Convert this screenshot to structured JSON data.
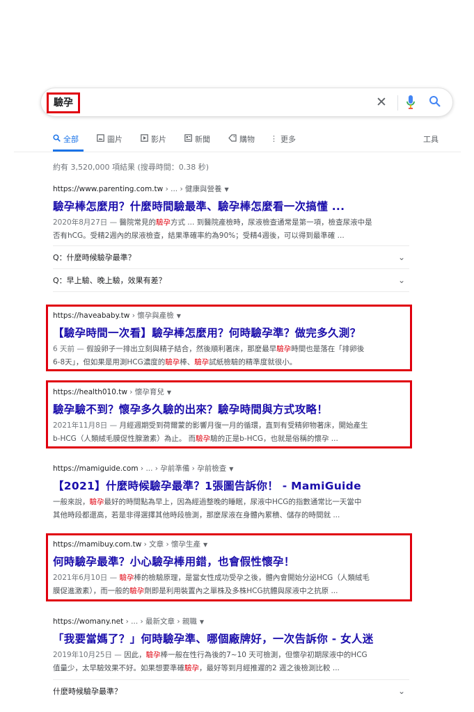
{
  "search": {
    "query": "驗孕",
    "clear_icon": "close-icon",
    "mic_icon": "microphone-icon",
    "search_icon": "search-icon"
  },
  "tabs": [
    {
      "label": "全部",
      "icon": "search-icon"
    },
    {
      "label": "圖片",
      "icon": "image-icon"
    },
    {
      "label": "影片",
      "icon": "video-icon"
    },
    {
      "label": "新聞",
      "icon": "news-icon"
    },
    {
      "label": "購物",
      "icon": "tag-icon"
    },
    {
      "label": "更多",
      "icon": "more-icon"
    },
    {
      "label": "工具",
      "icon": ""
    }
  ],
  "stats": "約有 3,520,000 項結果 (搜尋時間：0.38 秒)",
  "results": [
    {
      "site": "https://www.parenting.com.tw",
      "crumbs": " › ... › 健康與營養",
      "title": "驗孕棒怎麼用？什麼時間驗最準、驗孕棒怎麼看一次搞懂 ...",
      "date": "2020年8月27日 —",
      "line1a": " 醫院常見的",
      "line1hl": "驗孕",
      "line1b": "方式 ... 到醫院產檢時，尿液檢查通常是第一項，檢查尿液中是",
      "line2": "否有hCG。受精2週內的尿液檢查，結果準確率約為90%；受精4週後，可以得到最準確 ..."
    },
    {
      "site": "https://haveababy.tw",
      "crumbs": " › 懷孕與產檢",
      "title": "【驗孕時間一次看】驗孕棒怎麼用？何時驗孕準？做完多久測？",
      "date": "6 天前 —",
      "line1a": " 假設卵子一排出立刻與精子結合，然後順利著床，那麼最早",
      "line1hl": "驗孕",
      "line1b": "時間也是落在「排卵後",
      "line2a": "6-8天」，但如果是用測HCG濃度的",
      "line2hl1": "驗孕",
      "line2b": "棒、",
      "line2hl2": "驗孕",
      "line2c": "試紙檢驗的精準度就很小。"
    },
    {
      "site": "https://health010.tw",
      "crumbs": " › 懷孕育兒",
      "title": "驗孕驗不到？懷孕多久驗的出來？驗孕時間與方式攻略！",
      "date": "2021年11月8日 —",
      "line1": " 月經週期受到荷爾蒙的影響月復一月的循環，直到有受精卵物著床，開始產生",
      "line2a": "b-HCG（人類絨毛膜促性腺激素）為止。 而",
      "line2hl": "驗孕",
      "line2b": "驗的正是b-HCG，也就是俗稱的懷孕 ..."
    },
    {
      "site": "https://mamiguide.com",
      "crumbs": " › ... › 孕前準備 › 孕前檢查",
      "title": "【2021】什麼時候驗孕最準？1張圖告訴你！ - MamiGuide",
      "line1a": "一般來說，",
      "line1hl": "驗孕",
      "line1b": "最好的時間點為早上，因為經過整晚的睡眠，尿液中HCG的指數通常比一天當中",
      "line2": "其他時段都還高，若是非得選擇其他時段檢測，那麼尿液在身體內累積、儲存的時間就 ..."
    },
    {
      "site": "https://mamibuy.com.tw",
      "crumbs": " › 文章 › 懷孕生產",
      "title": "何時驗孕最準？小心驗孕棒用錯，也會假性懷孕！",
      "date": "2021年6月10日 —",
      "line1a": " ",
      "line1hl": "驗孕",
      "line1b": "棒的檢驗原理，是當女性成功受孕之後，體內會開始分泌HCG（人類絨毛",
      "line2a": "膜促進激素），而一般的",
      "line2hl": "驗孕",
      "line2b": "劑即是利用裝置內之單株及多株HCG抗體與尿液中之抗原 ..."
    },
    {
      "site": "https://womany.net",
      "crumbs": " › ... › 最新文章 › 親職",
      "title": "「我要當媽了？」何時驗孕準、哪個廠牌好，一次告訴你 - 女人迷",
      "date": "2019年10月25日 —",
      "line1a": " 因此，",
      "line1hl": "驗孕",
      "line1b": "棒一般在性行為後的7~10 天可檢測，但懷孕初期尿液中的HCG",
      "line2a": "值量少，太早驗效果不好。如果想要準確",
      "line2hl": "驗孕",
      "line2b": "，最好等到月經推遲的2 週之後檢測比較 ..."
    }
  ],
  "paa": [
    "Q：什麼時候驗孕最準？",
    "Q：早上驗、晚上驗，效果有差？",
    "什麼時候驗孕最準？"
  ],
  "highlight_color": "#e0000e",
  "link_color": "#1a0dab"
}
